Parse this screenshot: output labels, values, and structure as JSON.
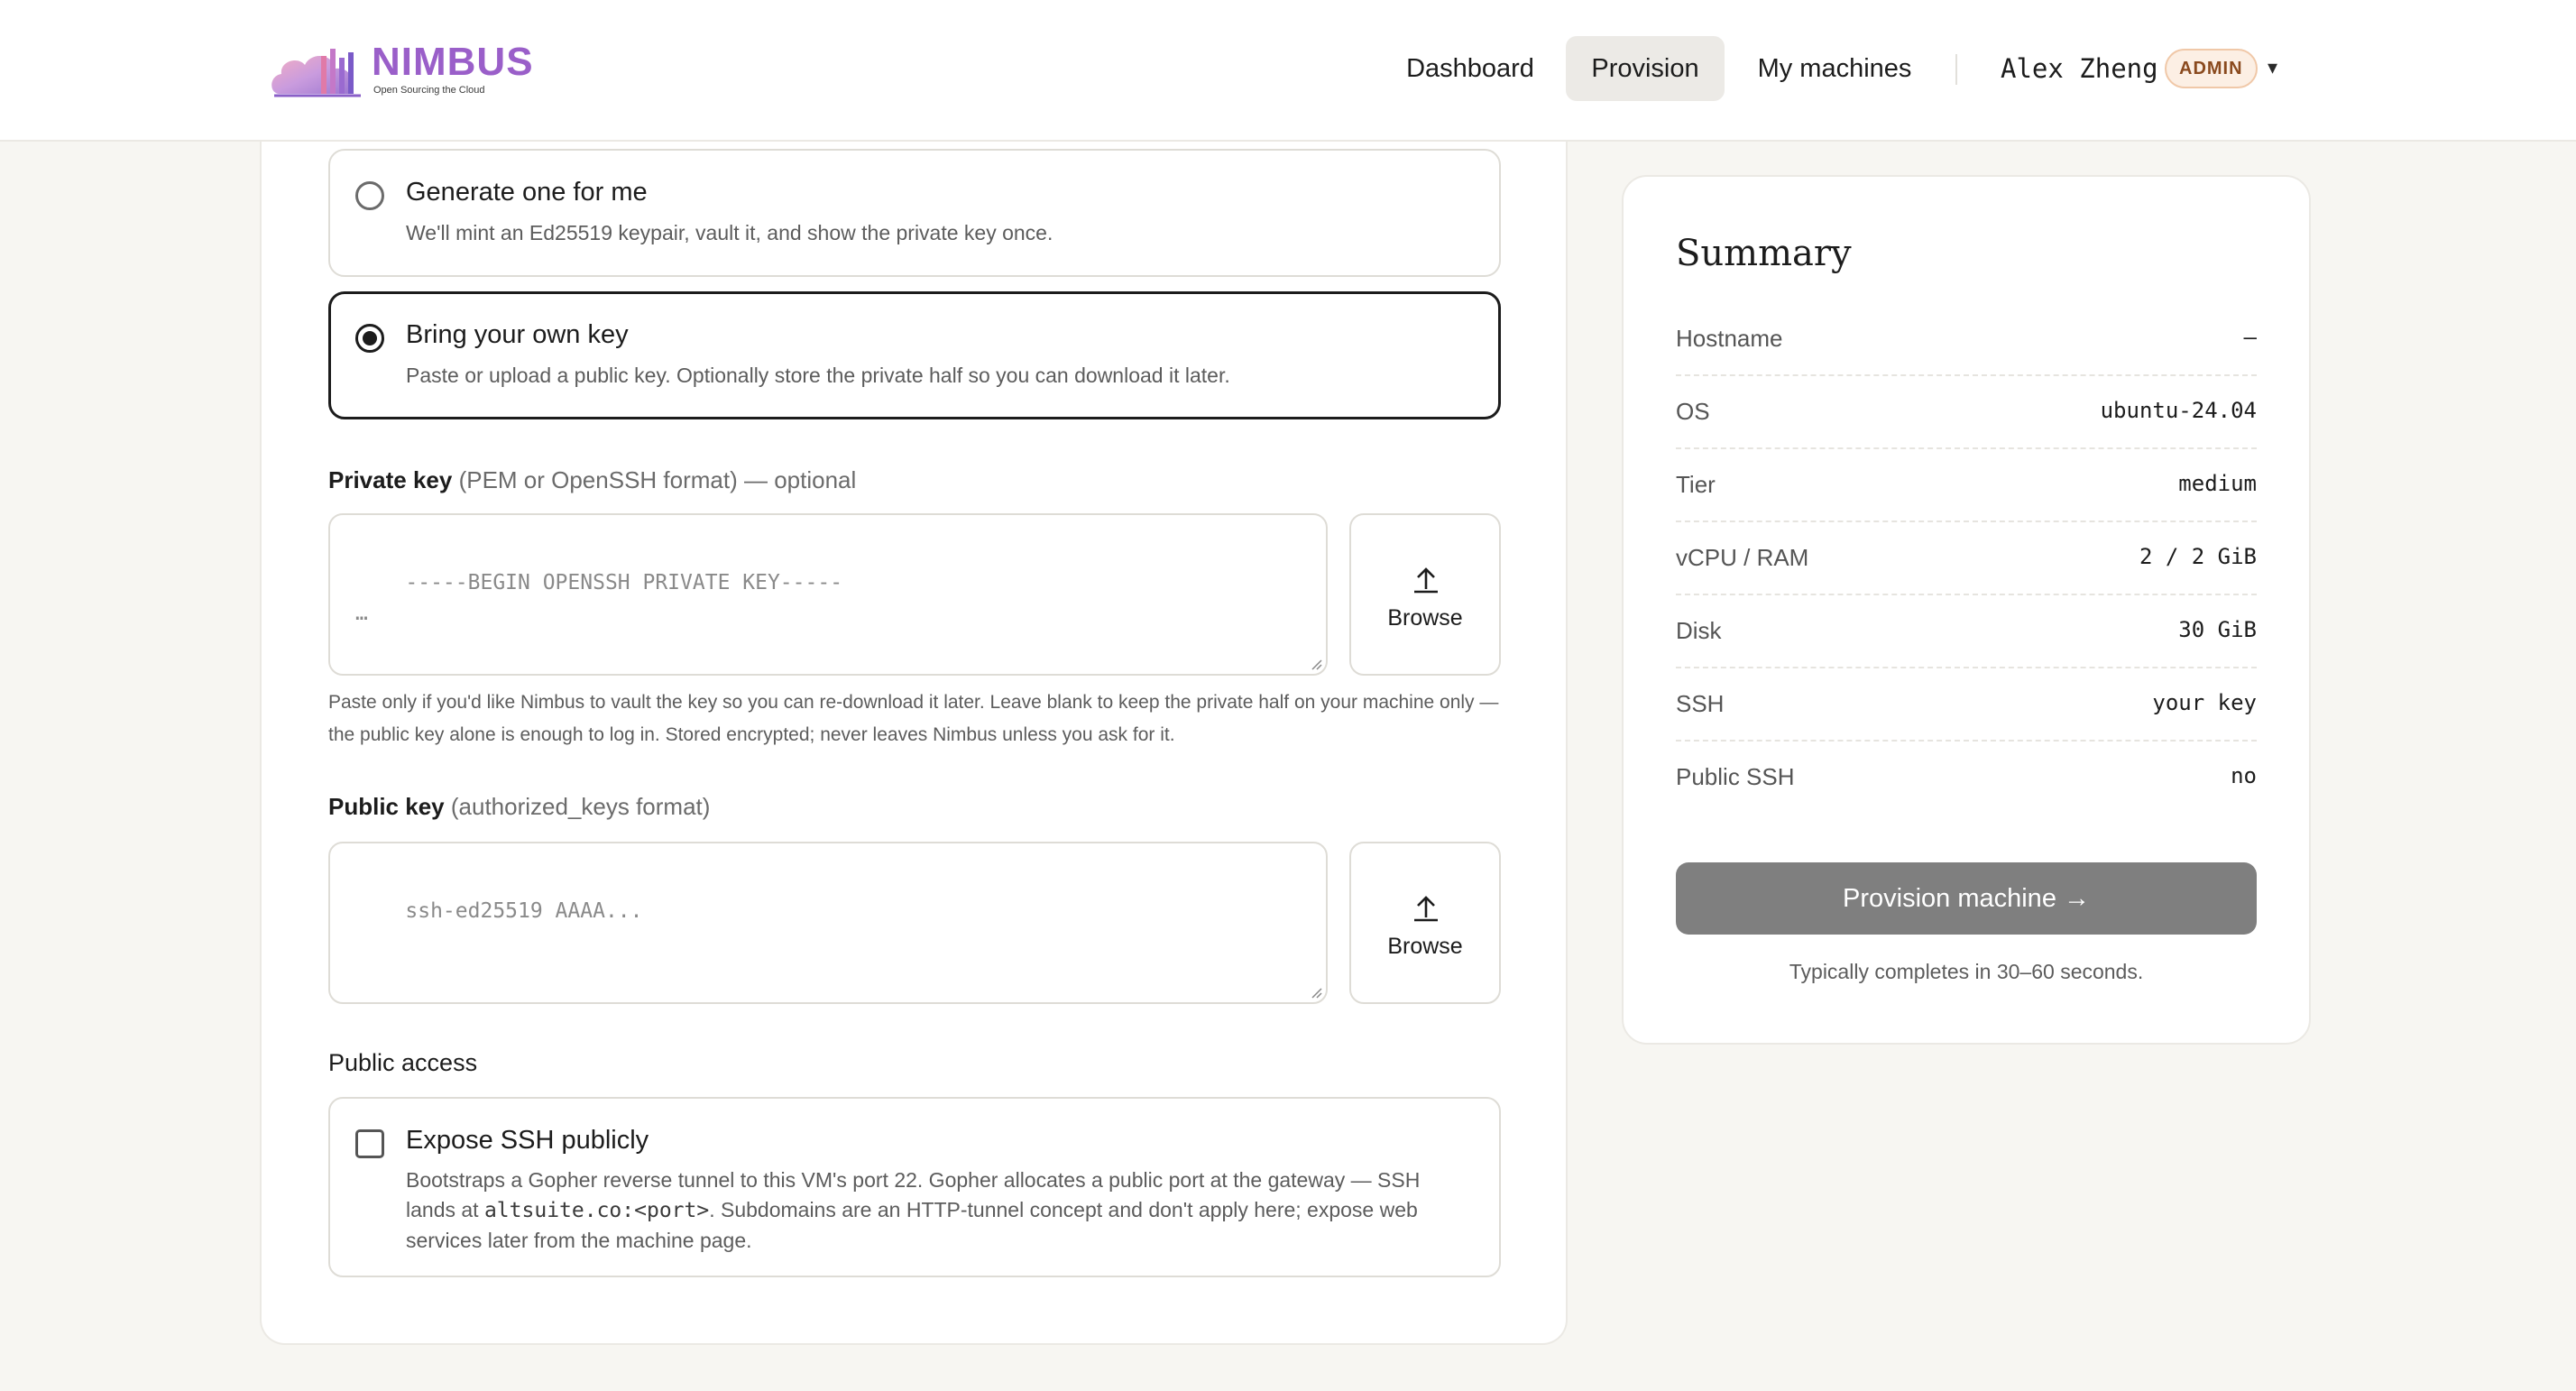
{
  "header": {
    "logo_text": "NIMBUS",
    "logo_tagline": "Open Sourcing the Cloud",
    "nav": {
      "dashboard": "Dashboard",
      "provision": "Provision",
      "machines": "My machines"
    },
    "user": {
      "name": "Alex Zheng",
      "badge": "ADMIN",
      "caret": "▾"
    }
  },
  "key_options": [
    {
      "title": "Generate one for me",
      "description": "We'll mint an Ed25519 keypair, vault it, and show the private key once.",
      "selected": false
    },
    {
      "title": "Bring your own key",
      "description": "Paste or upload a public key. Optionally store the private half so you can download it later.",
      "selected": true
    }
  ],
  "private_key": {
    "label": "Private key",
    "hint": "(PEM or OpenSSH format) — optional",
    "placeholder": "-----BEGIN OPENSSH PRIVATE KEY-----\n…",
    "browse_label": "Browse",
    "help": "Paste only if you'd like Nimbus to vault the key so you can re-download it later. Leave blank to keep the private half on your machine only — the public key alone is enough to log in. Stored encrypted; never leaves Nimbus unless you ask for it."
  },
  "public_key": {
    "label": "Public key",
    "hint": "(authorized_keys format)",
    "placeholder": "ssh-ed25519 AAAA...",
    "browse_label": "Browse"
  },
  "public_access": {
    "section_label": "Public access",
    "title": "Expose SSH publicly",
    "checked": false,
    "desc_before": "Bootstraps a Gopher reverse tunnel to this VM's port 22. Gopher allocates a public port at the gateway — SSH lands at ",
    "desc_code": "altsuite.co:<port>",
    "desc_after": ". Subdomains are an HTTP-tunnel concept and don't apply here; expose web services later from the machine page."
  },
  "summary": {
    "title": "Summary",
    "rows": [
      {
        "key": "Hostname",
        "value": "–"
      },
      {
        "key": "OS",
        "value": "ubuntu-24.04"
      },
      {
        "key": "Tier",
        "value": "medium"
      },
      {
        "key": "vCPU / RAM",
        "value": "2 / 2 GiB"
      },
      {
        "key": "Disk",
        "value": "30 GiB"
      },
      {
        "key": "SSH",
        "value": "your key"
      },
      {
        "key": "Public SSH",
        "value": "no"
      }
    ],
    "button_label": "Provision machine →",
    "note": "Typically completes in 30–60 seconds."
  },
  "colors": {
    "accent_logo": "#9a5fc9",
    "button_disabled": "#7f7f7f",
    "badge_bg": "#fcefe4"
  }
}
